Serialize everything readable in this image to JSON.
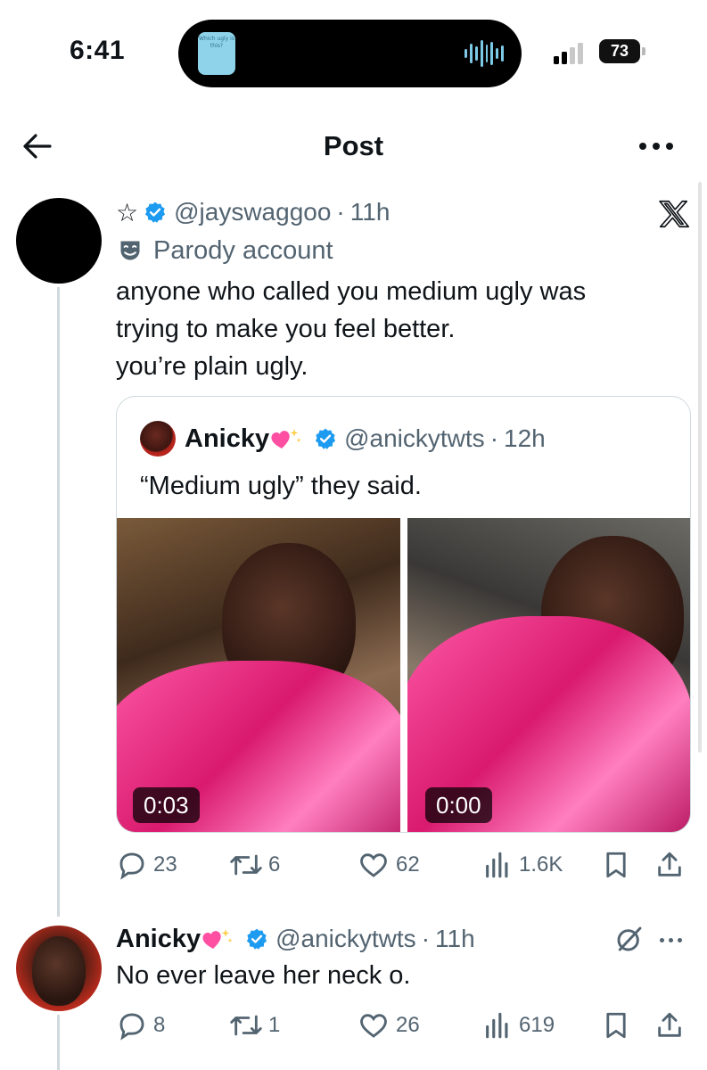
{
  "status_bar": {
    "time": "6:41",
    "island_thumb_text": "Which ugly is this?",
    "battery": "73"
  },
  "header": {
    "title": "Post"
  },
  "post": {
    "star": "☆",
    "handle": "@jayswaggoo",
    "separator": "·",
    "time": "11h",
    "parody_label": "Parody account",
    "text_lines": [
      "anyone who called you medium ugly was",
      "trying to make you feel better.",
      "you’re plain ugly."
    ],
    "quote": {
      "name": "Anicky",
      "handle": "@anickytwts",
      "time": "12h",
      "text": "“Medium ugly” they said.",
      "videos": [
        {
          "duration": "0:03"
        },
        {
          "duration": "0:00"
        }
      ]
    },
    "actions": {
      "replies": "23",
      "reposts": "6",
      "likes": "62",
      "views": "1.6K"
    }
  },
  "reply": {
    "name": "Anicky",
    "handle": "@anickytwts",
    "time": "11h",
    "text": "No ever leave her neck o.",
    "actions": {
      "replies": "8",
      "reposts": "1",
      "likes": "26",
      "views": "619"
    }
  },
  "colors": {
    "text": "#0f1419",
    "secondary": "#536471",
    "verified": "#1d9bf0",
    "border": "#cfd9de",
    "heart_emoji": "#ff4fa3"
  }
}
